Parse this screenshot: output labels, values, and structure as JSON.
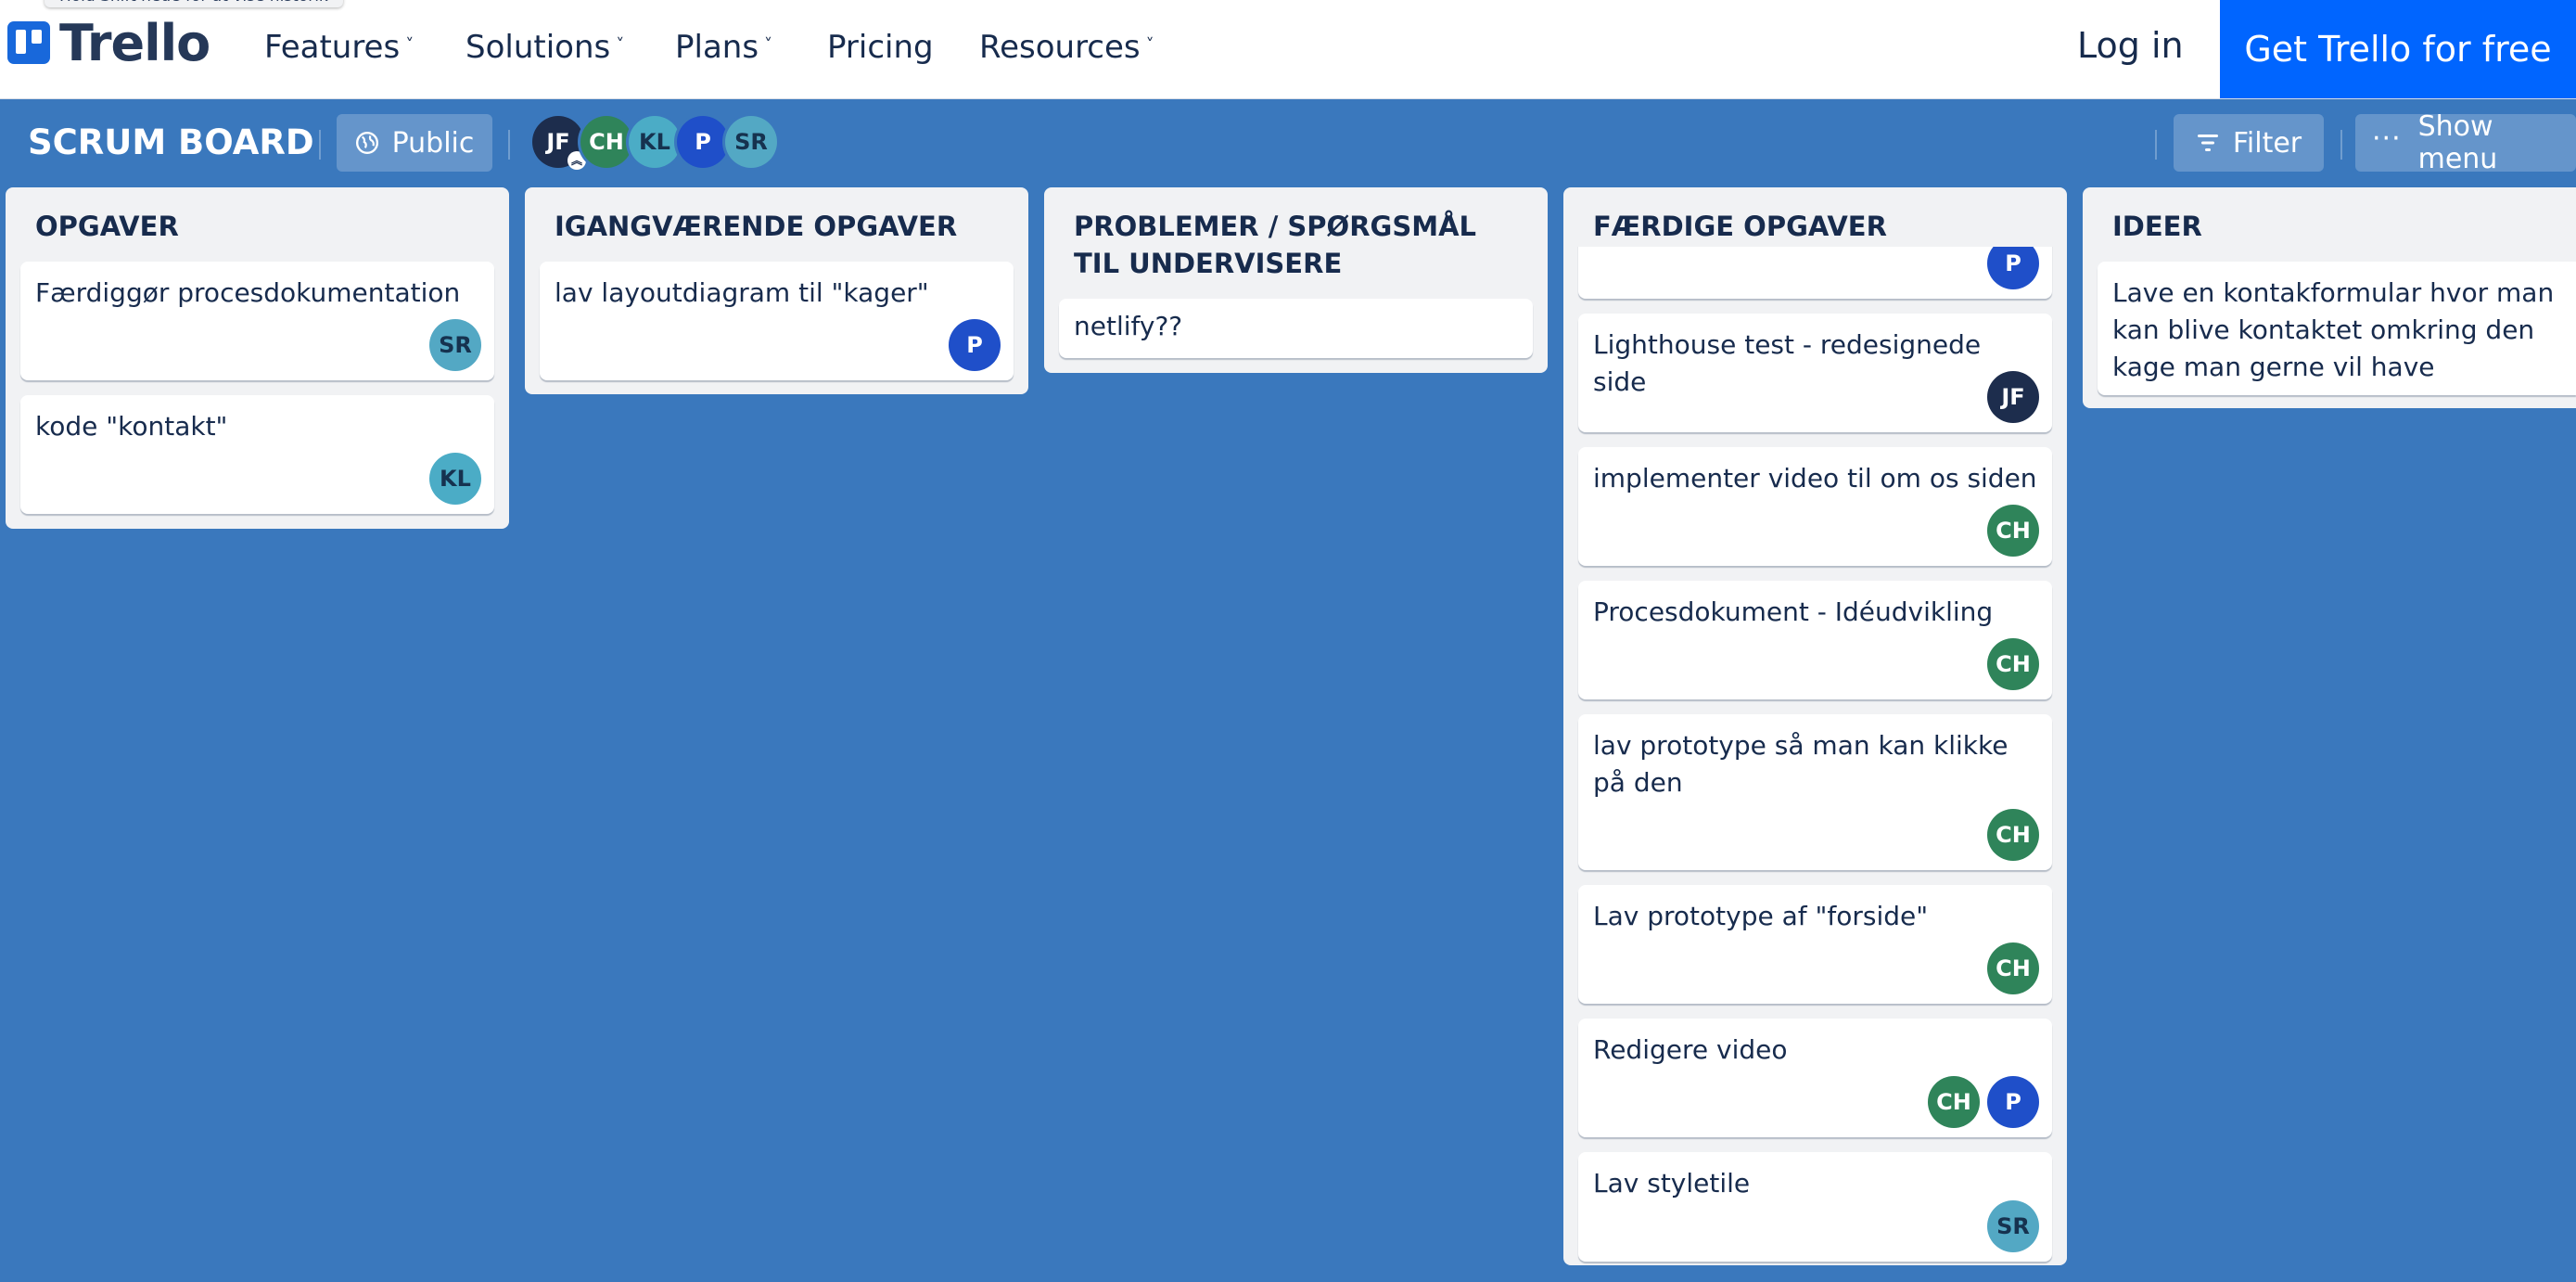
{
  "topnav": {
    "tooltip": "Hold Shift nede for at vise historik",
    "logo_text": "Trello",
    "items": [
      {
        "label": "Features",
        "has_menu": true
      },
      {
        "label": "Solutions",
        "has_menu": true
      },
      {
        "label": "Plans",
        "has_menu": true
      },
      {
        "label": "Pricing",
        "has_menu": false
      },
      {
        "label": "Resources",
        "has_menu": true
      }
    ],
    "chevron": "˅",
    "login": "Log in",
    "cta": "Get Trello for free"
  },
  "board": {
    "title": "SCRUM BOARD",
    "visibility": "Public",
    "members": [
      "JF",
      "CH",
      "KL",
      "P",
      "SR"
    ],
    "filter": "Filter",
    "show_menu": "Show menu"
  },
  "lists": [
    {
      "title": "OPGAVER",
      "cards": [
        {
          "title": "Færdiggør procesdokumentation",
          "members": [
            "SR"
          ]
        },
        {
          "title": "kode \"kontakt\"",
          "members": [
            "KL"
          ]
        }
      ]
    },
    {
      "title": "IGANGVÆRENDE OPGAVER",
      "cards": [
        {
          "title": "lav layoutdiagram til \"kager\"",
          "members": [
            "P"
          ]
        }
      ]
    },
    {
      "title": "PROBLEMER / SPØRGSMÅL TIL UNDERVISERE",
      "cards": [
        {
          "title": "netlify??",
          "members": []
        }
      ]
    },
    {
      "title": "FÆRDIGE OPGAVER",
      "cards": [
        {
          "title": "",
          "members": [
            "P"
          ]
        },
        {
          "title": "Lighthouse test - redesignede side",
          "members": [
            "JF"
          ]
        },
        {
          "title": "implementer video til om os siden",
          "members": [
            "CH"
          ]
        },
        {
          "title": "Procesdokument - Idéudvikling",
          "members": [
            "CH"
          ]
        },
        {
          "title": "lav prototype så man kan klikke på den",
          "members": [
            "CH"
          ]
        },
        {
          "title": "Lav prototype af \"forside\"",
          "members": [
            "CH"
          ]
        },
        {
          "title": "Redigere video",
          "members": [
            "CH",
            "P"
          ]
        },
        {
          "title": "Lav styletile",
          "members": [
            "SR"
          ]
        }
      ]
    },
    {
      "title": "IDEER",
      "cards": [
        {
          "title": "Lave en kontakformular hvor man kan blive kontaktet omkring den kage man gerne vil have",
          "members": []
        }
      ]
    }
  ],
  "colors": {
    "board_bg": "#3a78bd",
    "cta": "#0065ff",
    "JF": "#1d2d4d",
    "CH": "#2f845a",
    "KL": "#4bacc6",
    "P": "#1f4fc9",
    "SR": "#53a8c4"
  }
}
